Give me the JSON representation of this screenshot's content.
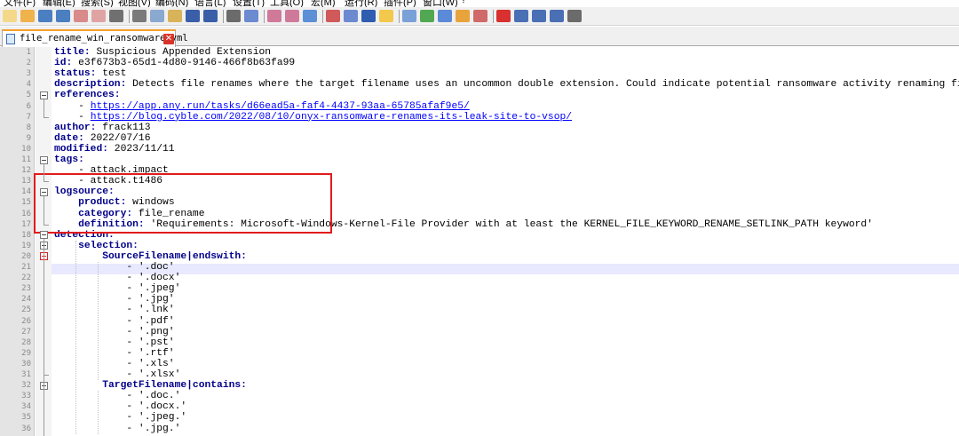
{
  "menu": [
    "文件(F)",
    "编辑(E)",
    "搜索(S)",
    "视图(V)",
    "编码(N)",
    "语言(L)",
    "设置(T)",
    "工具(O)",
    "宏(M)",
    "运行(R)",
    "插件(P)",
    "窗口(W)",
    "?"
  ],
  "tab": {
    "title": "file_rename_win_ransomware.yml"
  },
  "lines": [
    [
      {
        "t": "title: ",
        "c": "k"
      },
      {
        "t": "Suspicious Appended Extension"
      }
    ],
    [
      {
        "t": "id: ",
        "c": "k"
      },
      {
        "t": "e3f673b3-65d1-4d80-9146-466f8b63fa99"
      }
    ],
    [
      {
        "t": "status: ",
        "c": "k"
      },
      {
        "t": "test"
      }
    ],
    [
      {
        "t": "description: ",
        "c": "k"
      },
      {
        "t": "Detects file renames where the target filename uses an uncommon double extension. Could indicate potential ransomware activity renaming files and adding"
      }
    ],
    [
      {
        "t": "references:",
        "c": "k"
      }
    ],
    [
      {
        "t": "    - "
      },
      {
        "t": "https://app.any.run/tasks/d66ead5a-faf4-4437-93aa-65785afaf9e5/",
        "c": "link"
      }
    ],
    [
      {
        "t": "    - "
      },
      {
        "t": "https://blog.cyble.com/2022/08/10/onyx-ransomware-renames-its-leak-site-to-vsop/",
        "c": "link"
      }
    ],
    [
      {
        "t": "author: ",
        "c": "k"
      },
      {
        "t": "frack113"
      }
    ],
    [
      {
        "t": "date: ",
        "c": "k"
      },
      {
        "t": "2022/07/16"
      }
    ],
    [
      {
        "t": "modified: ",
        "c": "k"
      },
      {
        "t": "2023/11/11"
      }
    ],
    [
      {
        "t": "tags:",
        "c": "k"
      }
    ],
    [
      {
        "t": "    - attack.impact"
      }
    ],
    [
      {
        "t": "    - attack.t1486"
      }
    ],
    [
      {
        "t": "logsource:",
        "c": "k"
      }
    ],
    [
      {
        "t": "    "
      },
      {
        "t": "product: ",
        "c": "k"
      },
      {
        "t": "windows"
      }
    ],
    [
      {
        "t": "    "
      },
      {
        "t": "category: ",
        "c": "k"
      },
      {
        "t": "file_rename"
      }
    ],
    [
      {
        "t": "    "
      },
      {
        "t": "definition: ",
        "c": "k"
      },
      {
        "t": "'Requirements: Microsoft-Windows-Kernel-File Provider with at least the KERNEL_FILE_KEYWORD_RENAME_SETLINK_PATH keyword'"
      }
    ],
    [
      {
        "t": "detection:",
        "c": "k"
      }
    ],
    [
      {
        "t": "    "
      },
      {
        "t": "selection:",
        "c": "k"
      }
    ],
    [
      {
        "t": "        "
      },
      {
        "t": "SourceFilename|endswith:",
        "c": "k"
      }
    ],
    [
      {
        "t": "            - '.doc'"
      }
    ],
    [
      {
        "t": "            - '.docx'"
      }
    ],
    [
      {
        "t": "            - '.jpeg'"
      }
    ],
    [
      {
        "t": "            - '.jpg'"
      }
    ],
    [
      {
        "t": "            - '.lnk'"
      }
    ],
    [
      {
        "t": "            - '.pdf'"
      }
    ],
    [
      {
        "t": "            - '.png'"
      }
    ],
    [
      {
        "t": "            - '.pst'"
      }
    ],
    [
      {
        "t": "            - '.rtf'"
      }
    ],
    [
      {
        "t": "            - '.xls'"
      }
    ],
    [
      {
        "t": "            - '.xlsx'"
      }
    ],
    [
      {
        "t": "        "
      },
      {
        "t": "TargetFilename|contains:",
        "c": "k"
      }
    ],
    [
      {
        "t": "            - '.doc.'"
      }
    ],
    [
      {
        "t": "            - '.docx.'"
      }
    ],
    [
      {
        "t": "            - '.jpeg.'"
      }
    ],
    [
      {
        "t": "            - '.jpg.'"
      }
    ]
  ],
  "colors": {
    "keyword": "#00008b",
    "link": "#0000ff",
    "highlight": "#e21b1b",
    "current_line": "#e8e8ff",
    "tab_accent": "#f79e2c"
  },
  "icons": [
    "new-file-icon",
    "open-file-icon",
    "save-icon",
    "save-all-icon",
    "close-icon",
    "close-all-icon",
    "print-icon",
    "cut-icon",
    "copy-icon",
    "paste-icon",
    "undo-icon",
    "redo-icon",
    "find-icon",
    "replace-icon",
    "zoom-in-icon",
    "zoom-out-icon",
    "sync-v-icon",
    "sync-h-icon",
    "word-wrap-icon",
    "show-all-chars-icon",
    "indent-guide-icon",
    "lang-icon",
    "doc-map-icon",
    "function-list-icon",
    "folder-workspace-icon",
    "monitor-icon",
    "record-macro-icon",
    "stop-record-icon",
    "play-macro-icon",
    "run-macro-multi-icon",
    "save-macro-icon"
  ]
}
